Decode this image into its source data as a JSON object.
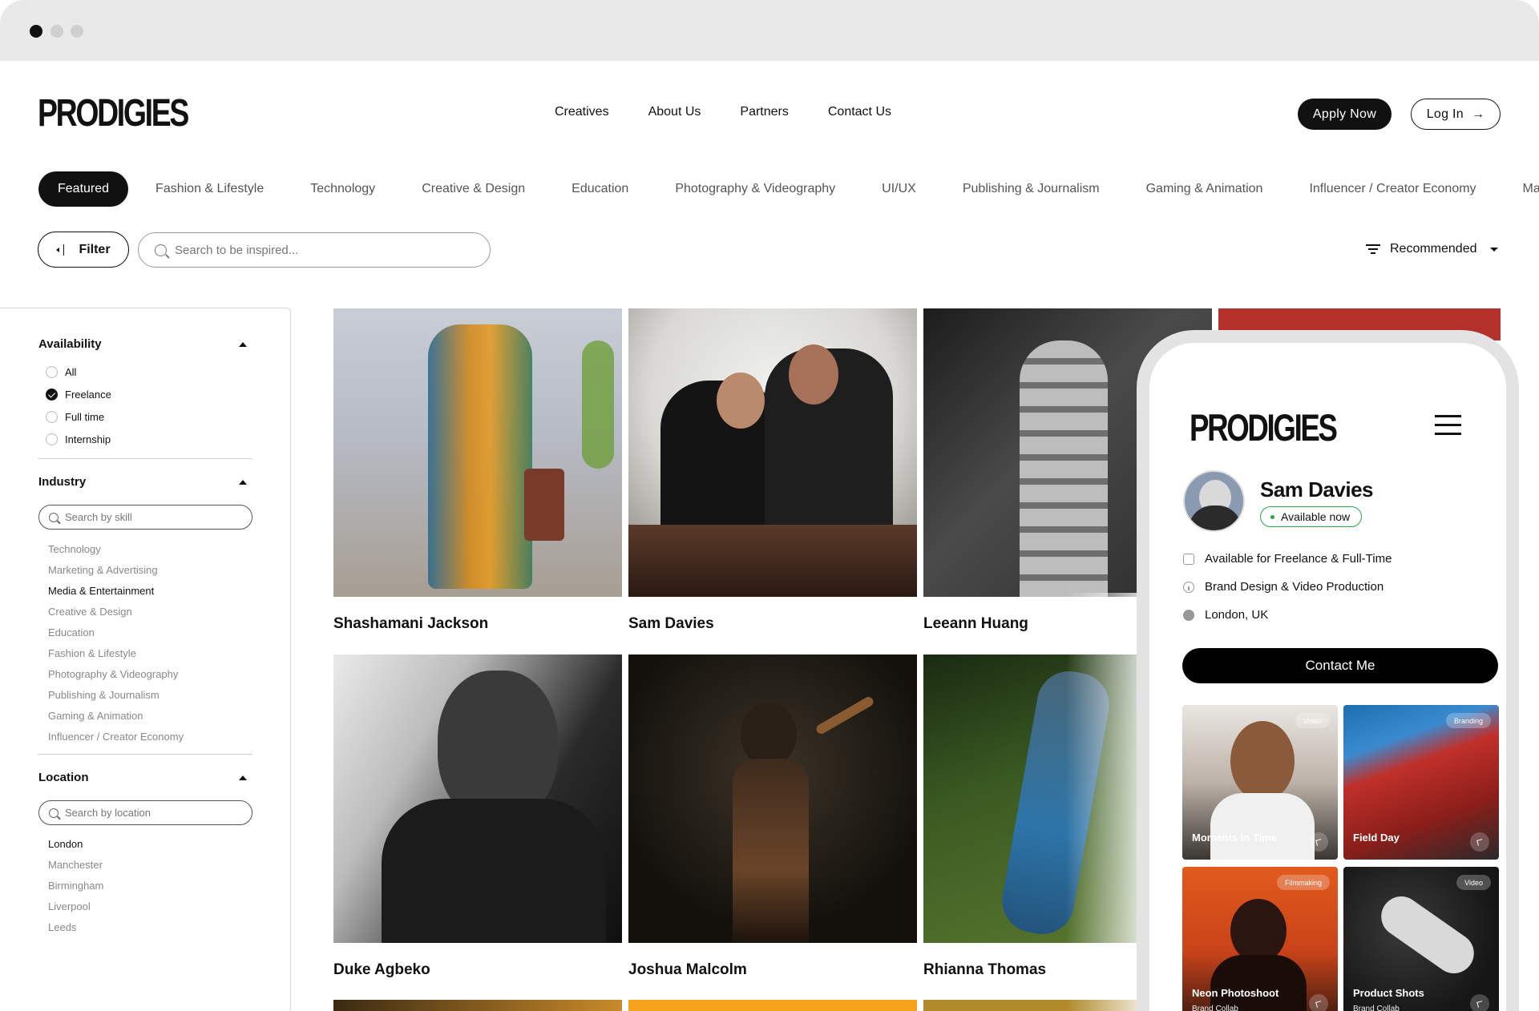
{
  "brand": {
    "logo": "PRODIGIES"
  },
  "nav": {
    "items": [
      "Creatives",
      "About Us",
      "Partners",
      "Contact Us"
    ]
  },
  "header": {
    "apply_label": "Apply Now",
    "login_label": "Log In",
    "login_arrow": "→"
  },
  "categories": {
    "active": "Featured",
    "items": [
      "Fashion & Lifestyle",
      "Technology",
      "Creative & Design",
      "Education",
      "Photography & Videography",
      "UI/UX",
      "Publishing & Journalism",
      "Gaming & Animation",
      "Influencer / Creator Economy",
      "Mar"
    ]
  },
  "toolbar": {
    "filter_label": "Filter",
    "search_placeholder": "Search to be inspired...",
    "sort_label": "Recommended"
  },
  "sidebar": {
    "availability": {
      "title": "Availability",
      "options": [
        {
          "label": "All",
          "checked": false
        },
        {
          "label": "Freelance",
          "checked": true
        },
        {
          "label": "Full time",
          "checked": false
        },
        {
          "label": "Internship",
          "checked": false
        }
      ]
    },
    "industry": {
      "title": "Industry",
      "search_placeholder": "Search by skill",
      "options": [
        "Technology",
        "Marketing & Advertising",
        "Media & Entertainment",
        "Creative & Design",
        "Education",
        "Fashion & Lifestyle",
        "Photography & Videography",
        "Publishing & Journalism",
        "Gaming & Animation",
        "Influencer / Creator Economy"
      ],
      "selected": "Media & Entertainment"
    },
    "location": {
      "title": "Location",
      "search_placeholder": "Search by location",
      "options": [
        "London",
        "Manchester",
        "Birmingham",
        "Liverpool",
        "Leeds"
      ],
      "selected": "London"
    }
  },
  "creatives": [
    {
      "name": "Shashamani Jackson"
    },
    {
      "name": "Sam Davies"
    },
    {
      "name": "Leeann Huang"
    },
    {
      "name": "Duke Agbeko"
    },
    {
      "name": "Joshua Malcolm"
    },
    {
      "name": "Rhianna Thomas"
    }
  ],
  "profile": {
    "name": "Sam Davies",
    "status": "Available now",
    "details": [
      "Available for Freelance & Full-Time",
      "Brand Design & Video Production",
      "London, UK"
    ],
    "contact_label": "Contact Me",
    "works": [
      {
        "title": "Moments in Time",
        "badge": "Video",
        "subtitle": ""
      },
      {
        "title": "Field Day",
        "badge": "Branding",
        "subtitle": ""
      },
      {
        "title": "Neon Photoshoot",
        "badge": "Filmmaking",
        "subtitle": "Brand Collab"
      },
      {
        "title": "Product Shots",
        "badge": "Video",
        "subtitle": "Brand Collab"
      }
    ]
  },
  "colors": {
    "accent": "#111111",
    "available_green": "#2aa84a"
  }
}
